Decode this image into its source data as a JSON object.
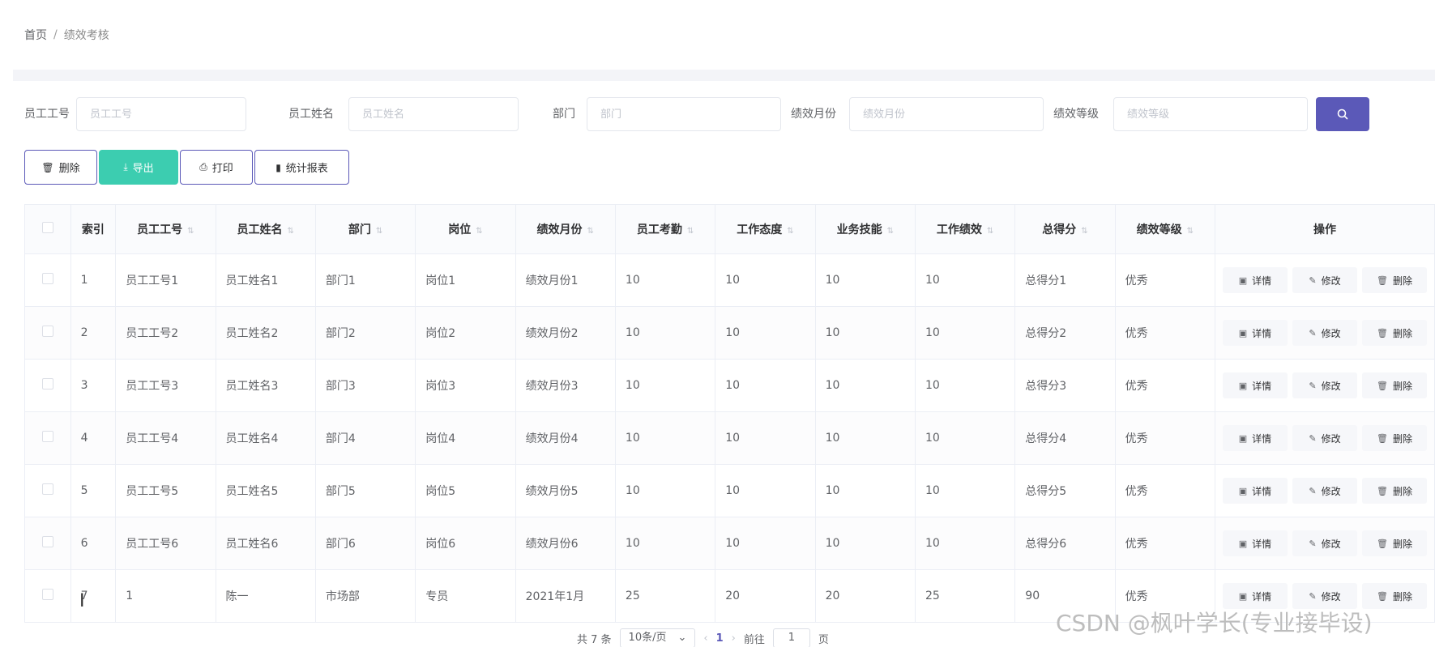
{
  "breadcrumb": {
    "home": "首页",
    "separator": "/",
    "current": "绩效考核"
  },
  "search": {
    "fields": [
      {
        "label": "员工工号",
        "placeholder": "员工工号"
      },
      {
        "label": "员工姓名",
        "placeholder": "员工姓名"
      },
      {
        "label": "部门",
        "placeholder": "部门"
      },
      {
        "label": "绩效月份",
        "placeholder": "绩效月份"
      },
      {
        "label": "绩效等级",
        "placeholder": "绩效等级"
      }
    ],
    "button_icon": "search-icon"
  },
  "toolbar": {
    "delete_label": "删除",
    "export_label": "导出",
    "print_label": "打印",
    "stats_label": "统计报表"
  },
  "table": {
    "headers": [
      "索引",
      "员工工号",
      "员工姓名",
      "部门",
      "岗位",
      "绩效月份",
      "员工考勤",
      "工作态度",
      "业务技能",
      "工作绩效",
      "总得分",
      "绩效等级",
      "操作"
    ],
    "rows": [
      [
        "1",
        "员工工号1",
        "员工姓名1",
        "部门1",
        "岗位1",
        "绩效月份1",
        "10",
        "10",
        "10",
        "10",
        "总得分1",
        "优秀"
      ],
      [
        "2",
        "员工工号2",
        "员工姓名2",
        "部门2",
        "岗位2",
        "绩效月份2",
        "10",
        "10",
        "10",
        "10",
        "总得分2",
        "优秀"
      ],
      [
        "3",
        "员工工号3",
        "员工姓名3",
        "部门3",
        "岗位3",
        "绩效月份3",
        "10",
        "10",
        "10",
        "10",
        "总得分3",
        "优秀"
      ],
      [
        "4",
        "员工工号4",
        "员工姓名4",
        "部门4",
        "岗位4",
        "绩效月份4",
        "10",
        "10",
        "10",
        "10",
        "总得分4",
        "优秀"
      ],
      [
        "5",
        "员工工号5",
        "员工姓名5",
        "部门5",
        "岗位5",
        "绩效月份5",
        "10",
        "10",
        "10",
        "10",
        "总得分5",
        "优秀"
      ],
      [
        "6",
        "员工工号6",
        "员工姓名6",
        "部门6",
        "岗位6",
        "绩效月份6",
        "10",
        "10",
        "10",
        "10",
        "总得分6",
        "优秀"
      ],
      [
        "7",
        "1",
        "陈一",
        "市场部",
        "专员",
        "2021年1月",
        "25",
        "20",
        "20",
        "25",
        "90",
        "优秀"
      ]
    ],
    "actions": {
      "detail": "详情",
      "edit": "修改",
      "delete": "删除"
    }
  },
  "pagination": {
    "total_text": "共 7 条",
    "page_size": "10条/页",
    "current_page": "1",
    "goto_prefix": "前往",
    "goto_value": "1",
    "goto_suffix": "页"
  },
  "watermark": "CSDN @枫叶学长(专业接毕设)",
  "colors": {
    "primary": "#5b59b8",
    "export": "#3ccdb0",
    "border": "#ebeef5"
  }
}
